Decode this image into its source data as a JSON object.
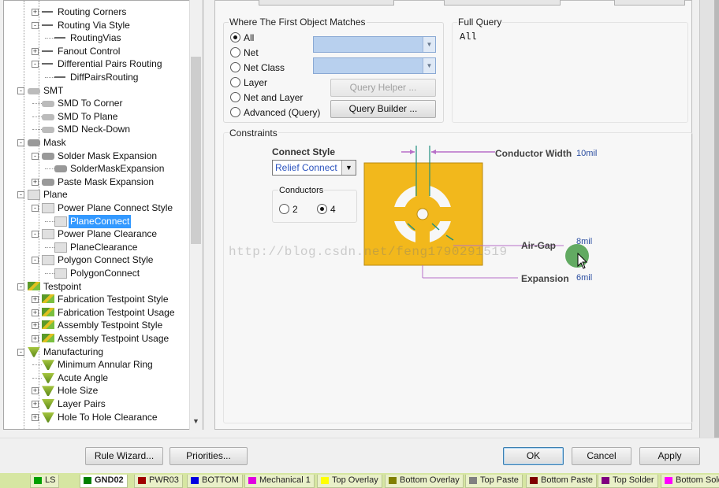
{
  "tree": {
    "items": [
      {
        "label": "Routing Corners",
        "icon": "routing-icon"
      },
      {
        "label": "Routing Via Style",
        "icon": "routing-icon"
      },
      {
        "label": "RoutingVias",
        "icon": "routing-icon"
      },
      {
        "label": "Fanout Control",
        "icon": "routing-icon"
      },
      {
        "label": "Differential Pairs Routing",
        "icon": "routing-icon"
      },
      {
        "label": "DiffPairsRouting",
        "icon": "routing-icon"
      },
      {
        "label": "SMT",
        "icon": "smt-icon"
      },
      {
        "label": "SMD To Corner",
        "icon": "smt-icon"
      },
      {
        "label": "SMD To Plane",
        "icon": "smt-icon"
      },
      {
        "label": "SMD Neck-Down",
        "icon": "smt-icon"
      },
      {
        "label": "Mask",
        "icon": "mask-icon"
      },
      {
        "label": "Solder Mask Expansion",
        "icon": "mask-icon"
      },
      {
        "label": "SolderMaskExpansion",
        "icon": "mask-icon"
      },
      {
        "label": "Paste Mask Expansion",
        "icon": "mask-icon"
      },
      {
        "label": "Plane",
        "icon": "plane-icon"
      },
      {
        "label": "Power Plane Connect Style",
        "icon": "plane-icon"
      },
      {
        "label": "PlaneConnect",
        "icon": "plane-icon"
      },
      {
        "label": "Power Plane Clearance",
        "icon": "plane-icon"
      },
      {
        "label": "PlaneClearance",
        "icon": "plane-icon"
      },
      {
        "label": "Polygon Connect Style",
        "icon": "plane-icon"
      },
      {
        "label": "PolygonConnect",
        "icon": "plane-icon"
      },
      {
        "label": "Testpoint",
        "icon": "testpoint-icon"
      },
      {
        "label": "Fabrication Testpoint Style",
        "icon": "testpoint-icon"
      },
      {
        "label": "Fabrication Testpoint Usage",
        "icon": "testpoint-icon"
      },
      {
        "label": "Assembly Testpoint Style",
        "icon": "testpoint-icon"
      },
      {
        "label": "Assembly Testpoint Usage",
        "icon": "testpoint-icon"
      },
      {
        "label": "Manufacturing",
        "icon": "manufacturing-icon"
      },
      {
        "label": "Minimum Annular Ring",
        "icon": "manufacturing-icon"
      },
      {
        "label": "Acute Angle",
        "icon": "manufacturing-icon"
      },
      {
        "label": "Hole Size",
        "icon": "manufacturing-icon"
      },
      {
        "label": "Layer Pairs",
        "icon": "manufacturing-icon"
      },
      {
        "label": "Hole To Hole Clearance",
        "icon": "manufacturing-icon"
      }
    ],
    "selected": "PlaneConnect"
  },
  "match": {
    "title": "Where The First Object Matches",
    "options": [
      "All",
      "Net",
      "Net Class",
      "Layer",
      "Net and Layer",
      "Advanced (Query)"
    ],
    "selected": "All",
    "query_helper": "Query Helper ...",
    "query_builder": "Query Builder ..."
  },
  "full_query": {
    "title": "Full Query",
    "value": "All"
  },
  "constraints": {
    "title": "Constraints",
    "connect_style_label": "Connect Style",
    "connect_style_value": "Relief Connect",
    "conductors_label": "Conductors",
    "conductor_options": [
      "2",
      "4"
    ],
    "conductor_selected": "4",
    "conductor_width_label": "Conductor Width",
    "conductor_width_value": "10mil",
    "air_gap_label": "Air-Gap",
    "air_gap_value": "8mil",
    "expansion_label": "Expansion",
    "expansion_value": "6mil"
  },
  "watermark": "http://blog.csdn.net/feng1790291519",
  "footer": {
    "rule_wizard": "Rule Wizard...",
    "priorities": "Priorities...",
    "ok": "OK",
    "cancel": "Cancel",
    "apply": "Apply"
  },
  "layer_tabs": [
    {
      "label": "LS",
      "color": "#00a000"
    },
    {
      "label": "GND02",
      "color": "#008000"
    },
    {
      "label": "PWR03",
      "color": "#a00000"
    },
    {
      "label": "BOTTOM",
      "color": "#0000e0"
    },
    {
      "label": "Mechanical 1",
      "color": "#e000e0"
    },
    {
      "label": "Top Overlay",
      "color": "#ffff00"
    },
    {
      "label": "Bottom Overlay",
      "color": "#808000"
    },
    {
      "label": "Top Paste",
      "color": "#808080"
    },
    {
      "label": "Bottom Paste",
      "color": "#800000"
    },
    {
      "label": "Top Solder",
      "color": "#800080"
    },
    {
      "label": "Bottom Sold",
      "color": "#ff00ff"
    }
  ],
  "colors": {
    "pad": "#f2b81c",
    "selection": "#3399ff",
    "accent_line": "#b76fc8"
  }
}
